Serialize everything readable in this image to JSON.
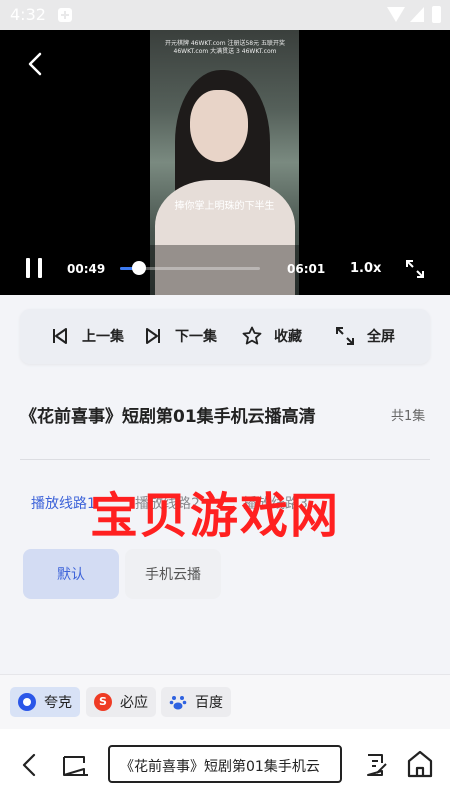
{
  "status_bar": {
    "time": "4:32"
  },
  "player": {
    "watermark_text": "开元棋牌 46WKT.com 注册送58元 五联开奖 46WKT.com 大满贯送 3 46WKT.com",
    "subtitle": "捧你掌上明珠的下半生",
    "current_time": "00:49",
    "total_time": "06:01",
    "progress": 0.136,
    "speed": "1.0x"
  },
  "actions": {
    "prev": "上一集",
    "next": "下一集",
    "favorite": "收藏",
    "fullscreen": "全屏"
  },
  "video": {
    "title": "《花前喜事》短剧第01集手机云播高清",
    "episode_count": "共1集"
  },
  "lines": [
    {
      "label": "播放线路1",
      "active": true
    },
    {
      "label": "播放线路2",
      "active": false
    },
    {
      "label": "播放线路3",
      "active": false
    }
  ],
  "watermark": "宝贝游戏网",
  "sources": [
    {
      "label": "默认",
      "active": true
    },
    {
      "label": "手机云播",
      "active": false
    }
  ],
  "engines": [
    {
      "label": "夸克",
      "icon": "quark-icon",
      "color": "#2b57e8"
    },
    {
      "label": "必应",
      "icon": "sogou-icon",
      "color": "#ef3b24"
    },
    {
      "label": "百度",
      "icon": "baidu-paw-icon",
      "color": "#2f62e0"
    }
  ],
  "bottom_nav": {
    "url_text": "《花前喜事》短剧第01集手机云"
  },
  "colors": {
    "accent": "#3d63d9",
    "watermark": "#ff2020"
  }
}
